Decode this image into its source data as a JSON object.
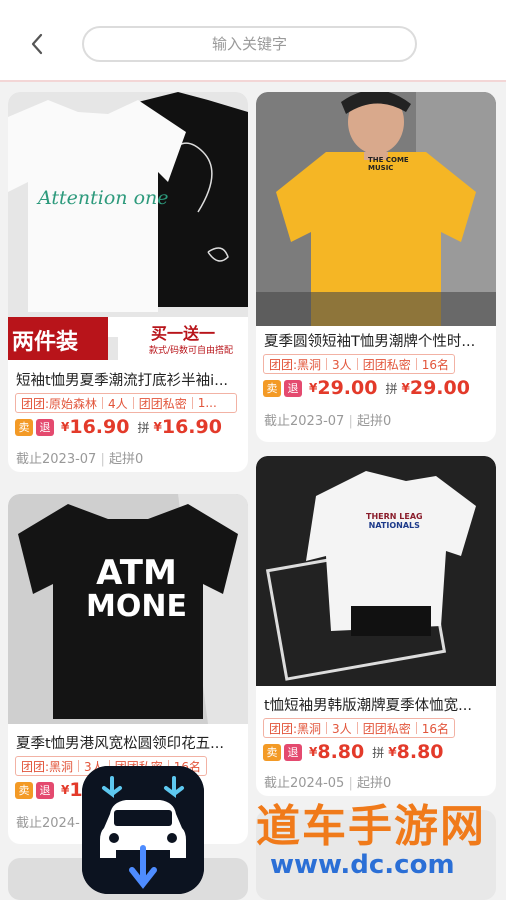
{
  "header": {
    "back_icon": "chevron-left-icon",
    "search_placeholder": "输入关键字"
  },
  "products": [
    {
      "title": "短袖t恤男夏季潮流打底衫半袖i...",
      "banner_left": "两件装",
      "banner_right": "买一送一",
      "banner_sub": "款式/码数可自由搭配",
      "shirt_text_1": "Attention one",
      "tags": [
        "团团:原始森林",
        "4人",
        "团团私密",
        "1..."
      ],
      "badge_sell": "卖",
      "badge_return": "退",
      "yen": "¥",
      "price": "16.90",
      "pin_label": "拼",
      "pin_price": "16.90",
      "deadline": "截止2023-07",
      "group": "起拼0"
    },
    {
      "title": "夏季圆领短袖T恤男潮牌个性时...",
      "shirt_text_1": "THE COME",
      "shirt_text_2": "MUSIC",
      "tags": [
        "团团:黑洞",
        "3人",
        "团团私密",
        "16名"
      ],
      "badge_sell": "卖",
      "badge_return": "退",
      "yen": "¥",
      "price": "29.00",
      "pin_label": "拼",
      "pin_price": "29.00",
      "deadline": "截止2023-07",
      "group": "起拼0"
    },
    {
      "title": "夏季t恤男港风宽松圆领印花五...",
      "shirt_text_1": "ATM",
      "shirt_text_2": "MONE",
      "tags": [
        "团团:黑洞",
        "3人",
        "团团私密",
        "16名"
      ],
      "badge_sell": "卖",
      "badge_return": "退",
      "yen": "¥",
      "price": "1",
      "deadline": "截止2024-",
      "group": ""
    },
    {
      "title": "t恤短袖男韩版潮牌夏季体恤宽...",
      "shirt_text_1": "THERN LEAG",
      "shirt_text_2": "NATIONALS",
      "tags": [
        "团团:黑洞",
        "3人",
        "团团私密",
        "16名"
      ],
      "badge_sell": "卖",
      "badge_return": "退",
      "yen": "¥",
      "price": "8.80",
      "pin_label": "拼",
      "pin_price": "8.80",
      "deadline": "截止2024-05",
      "group": "起拼0"
    }
  ],
  "overlay": {
    "app_icon": "car-download-icon",
    "watermark_text": "道车手游网",
    "watermark_url": "www.dc.com"
  },
  "colors": {
    "price_red": "#e33a2a",
    "tag_red": "#e2553b",
    "sell_orange": "#f39a26",
    "return_pink": "#e44a6f"
  }
}
